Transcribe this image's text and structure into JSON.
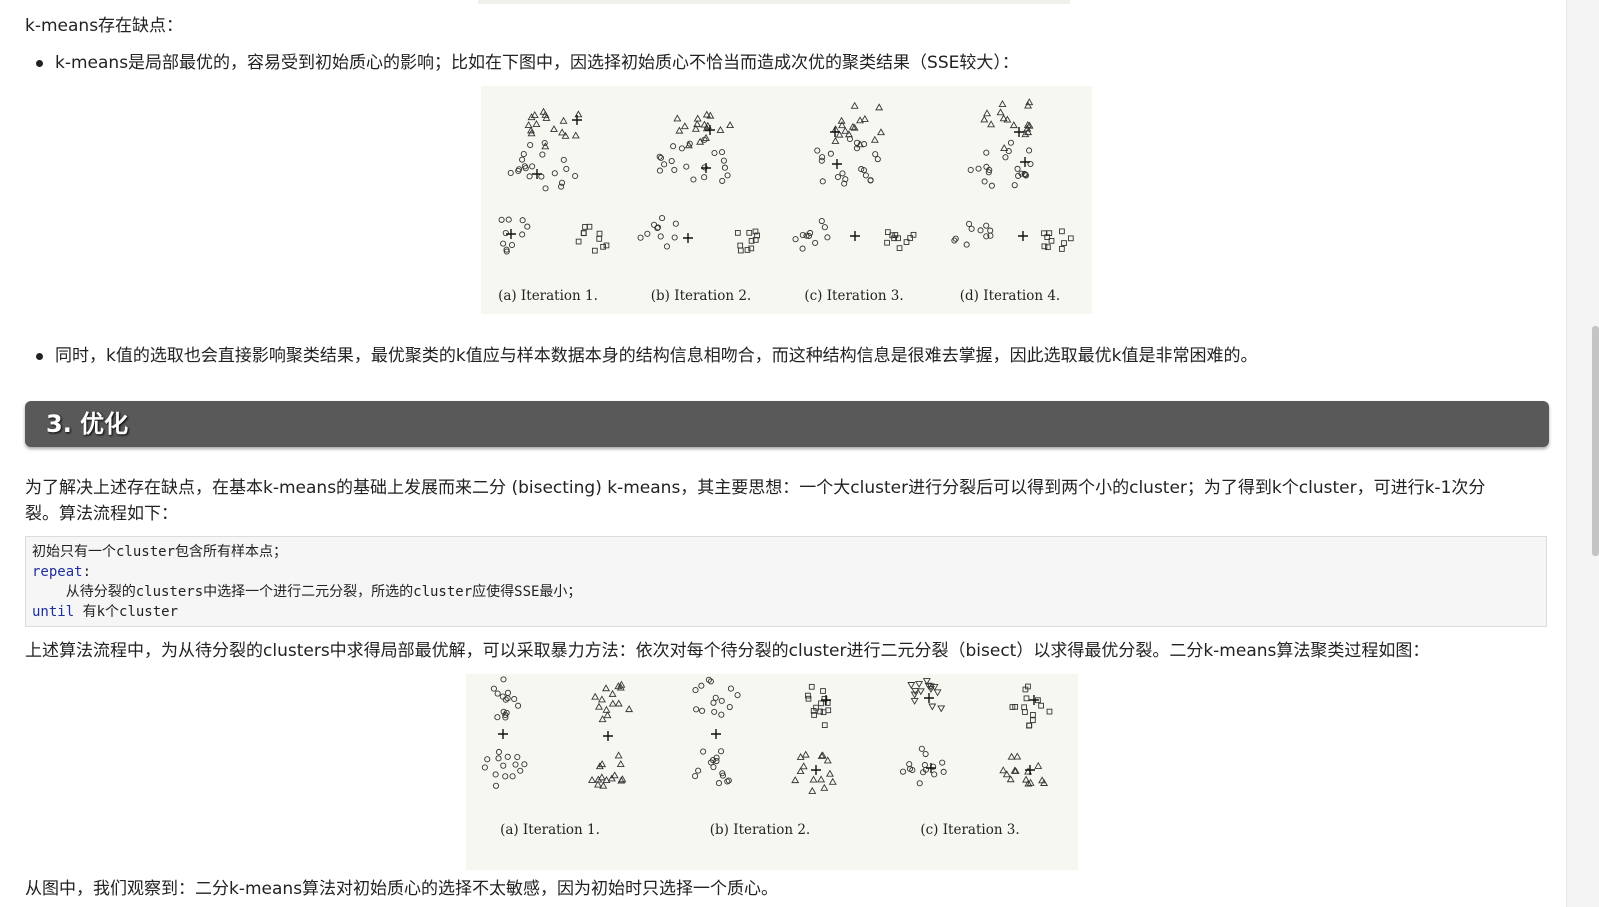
{
  "intro_line": "k-means存在缺点：",
  "bullets": [
    "k-means是局部最优的，容易受到初始质心的影响；比如在下图中，因选择初始质心不恰当而造成次优的聚类结果（SSE较大）：",
    "同时，k值的选取也会直接影响聚类结果，最优聚类的k值应与样本数据本身的结构信息相吻合，而这种结构信息是很难去掌握，因此选取最优k值是非常困难的。"
  ],
  "figure1": {
    "captions": [
      "(a) Iteration 1.",
      "(b) Iteration 2.",
      "(c) Iteration 3.",
      "(d) Iteration 4."
    ]
  },
  "section": {
    "title": "3. 优化"
  },
  "paragraph1": {
    "line1": "为了解决上述存在缺点，在基本k-means的基础上发展而来二分 (bisecting) k-means，其主要思想：一个大cluster进行分裂后可以得到两个小的cluster；为了得到k个cluster，可进行k-1次分",
    "line2": "裂。算法流程如下："
  },
  "code": {
    "line1": "初始只有一个cluster包含所有样本点；",
    "line2_kw": "repeat",
    "line2_rest": ":",
    "line3": "    从待分裂的clusters中选择一个进行二元分裂，所选的cluster应使得SSE最小；",
    "line4_kw": "until",
    "line4_rest": " 有k个cluster"
  },
  "paragraph2": "上述算法流程中，为从待分裂的clusters中求得局部最优解，可以采取暴力方法：依次对每个待分裂的cluster进行二元分裂（bisect）以求得最优分裂。二分k-means算法聚类过程如图：",
  "figure2": {
    "captions": [
      "(a) Iteration 1.",
      "(b) Iteration 2.",
      "(c) Iteration 3."
    ]
  },
  "conclusion": "从图中，我们观察到：二分k-means算法对初始质心的选择不太敏感，因为初始时只选择一个质心。"
}
